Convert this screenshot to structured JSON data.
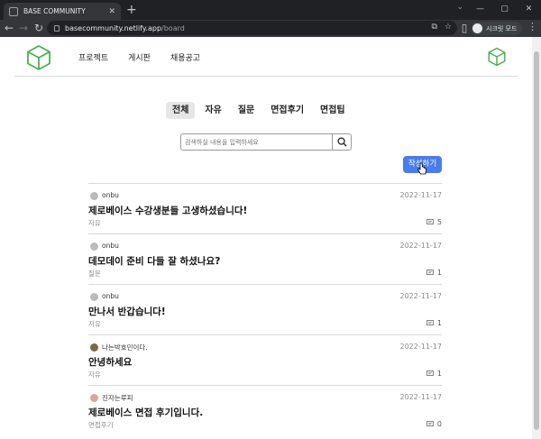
{
  "browser": {
    "tab_title": "BASE COMMUNITY",
    "url_host": "basecommunity.netlify.app",
    "url_path": "/board",
    "profile_label": "시크릿 모드"
  },
  "header": {
    "nav": [
      "프로젝트",
      "게시판",
      "채용공고"
    ],
    "logo_color": "#4caf50"
  },
  "categories": [
    "전체",
    "자유",
    "질문",
    "면접후기",
    "면접팁"
  ],
  "active_category": "전체",
  "search": {
    "placeholder": "검색하실 내용을 입력하세요"
  },
  "write_button": "작성하기",
  "posts": [
    {
      "author": "onbu",
      "date": "2022-11-17",
      "title": "제로베이스 수강생분들 고생하셨습니다!",
      "category": "자유",
      "comments": "5"
    },
    {
      "author": "onbu",
      "date": "2022-11-17",
      "title": "데모데이 준비 다들 잘 하셨나요?",
      "category": "질문",
      "comments": "1"
    },
    {
      "author": "onbu",
      "date": "2022-11-17",
      "title": "만나서 반갑습니다!",
      "category": "자유",
      "comments": "1"
    },
    {
      "author": "나는박호민이다.",
      "date": "2022-11-17",
      "title": "안녕하세요",
      "category": "자유",
      "comments": "1"
    },
    {
      "author": "진자는루피",
      "date": "2022-11-17",
      "title": "제로베이스 면접 후기입니다.",
      "category": "면접후기",
      "comments": "0"
    }
  ]
}
